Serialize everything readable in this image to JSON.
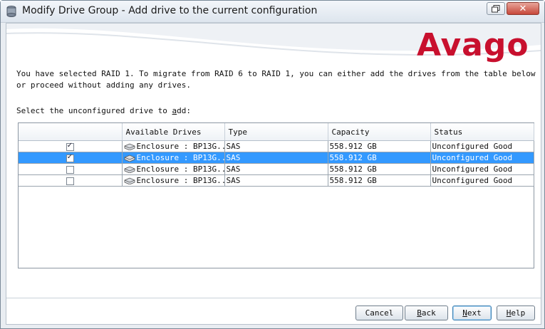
{
  "window": {
    "title": "Modify Drive Group - Add drive to the current configuration",
    "restore_icon": "restore-icon",
    "close_icon": "close-icon"
  },
  "brand": {
    "logo_text": "Avago"
  },
  "message": "You have selected RAID 1. To migrate from RAID 6 to RAID 1, you can either add the drives from the table below or proceed without adding any drives.",
  "select_label": {
    "before": "Select the unconfigured drive to ",
    "accel": "a",
    "after": "dd:"
  },
  "table": {
    "columns": [
      "",
      "Available Drives",
      "Type",
      "Capacity",
      "Status"
    ],
    "rows": [
      {
        "checked": true,
        "selected": false,
        "drive": "Enclosure : BP13G...",
        "type": "SAS",
        "capacity": "558.912 GB",
        "status": "Unconfigured Good"
      },
      {
        "checked": true,
        "selected": true,
        "drive": "Enclosure : BP13G...",
        "type": "SAS",
        "capacity": "558.912 GB",
        "status": "Unconfigured Good"
      },
      {
        "checked": false,
        "selected": false,
        "drive": "Enclosure : BP13G...",
        "type": "SAS",
        "capacity": "558.912 GB",
        "status": "Unconfigured Good"
      },
      {
        "checked": false,
        "selected": false,
        "drive": "Enclosure : BP13G...",
        "type": "SAS",
        "capacity": "558.912 GB",
        "status": "Unconfigured Good"
      }
    ]
  },
  "buttons": {
    "cancel": {
      "label": "Cancel"
    },
    "back": {
      "accel": "B",
      "rest": "ack"
    },
    "next": {
      "accel": "N",
      "rest": "ext"
    },
    "help": {
      "accel": "H",
      "rest": "elp"
    }
  },
  "colors": {
    "brand_red": "#c8102e",
    "selection": "#3399ff"
  }
}
